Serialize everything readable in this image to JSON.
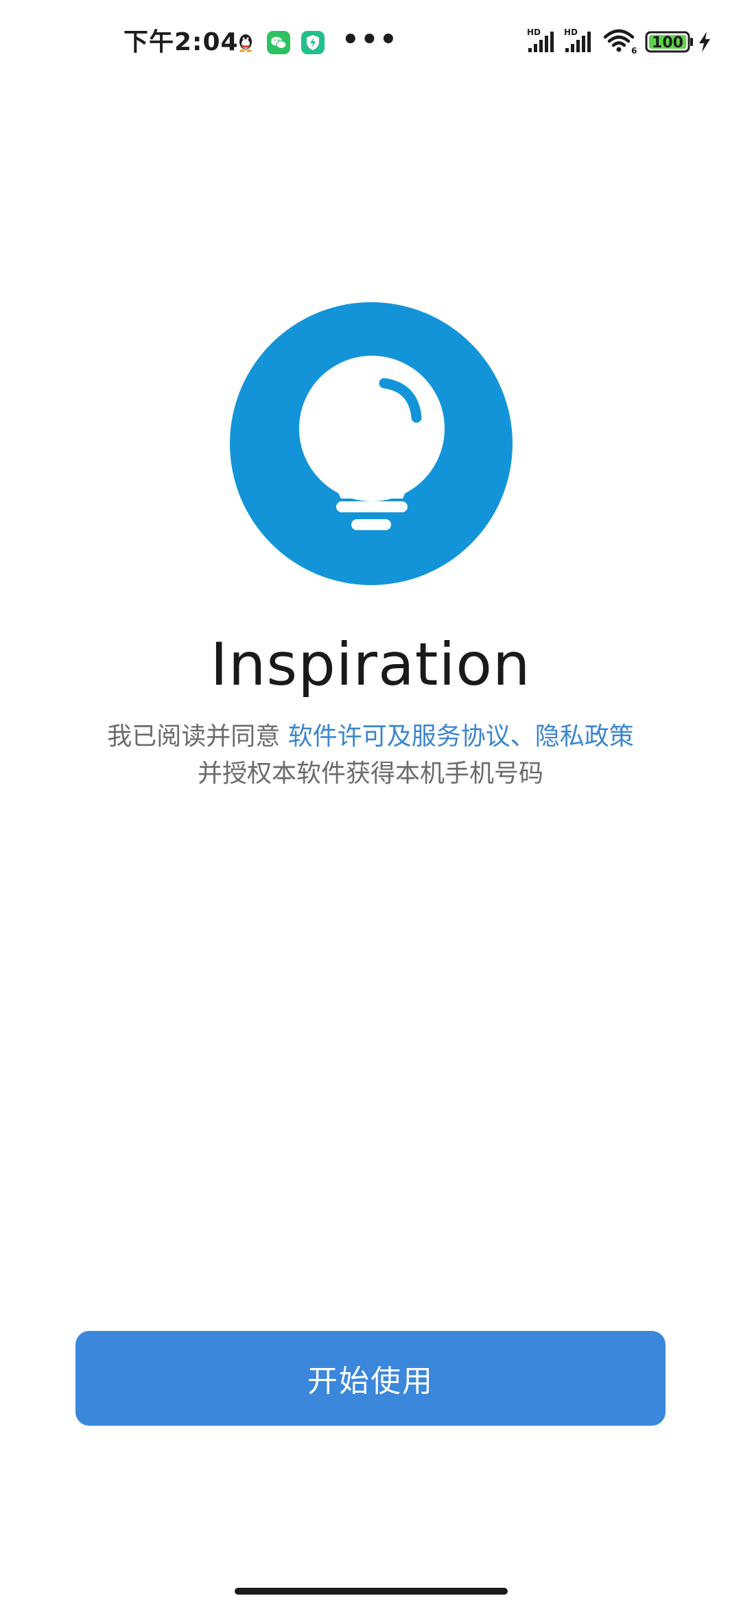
{
  "status_bar": {
    "time": "下午2:04",
    "notification_icons": [
      "qq-icon",
      "wechat-icon",
      "shield-app-icon"
    ],
    "more_indicator": "•••",
    "signal_label_1": "HD",
    "signal_label_2": "HD",
    "wifi_label": "6",
    "battery_level": "100",
    "charging": true
  },
  "app": {
    "logo_icon": "lightbulb-icon",
    "brand_color": "#1494d8",
    "title": "Inspiration"
  },
  "agreement": {
    "prefix": "我已阅读并同意 ",
    "license_link": "软件许可及服务协议",
    "separator": "、",
    "privacy_link": "隐私政策",
    "second_line": "并授权本软件获得本机手机号码",
    "link_color": "#3a86cf"
  },
  "actions": {
    "start_label": "开始使用",
    "button_color": "#3a87db"
  }
}
